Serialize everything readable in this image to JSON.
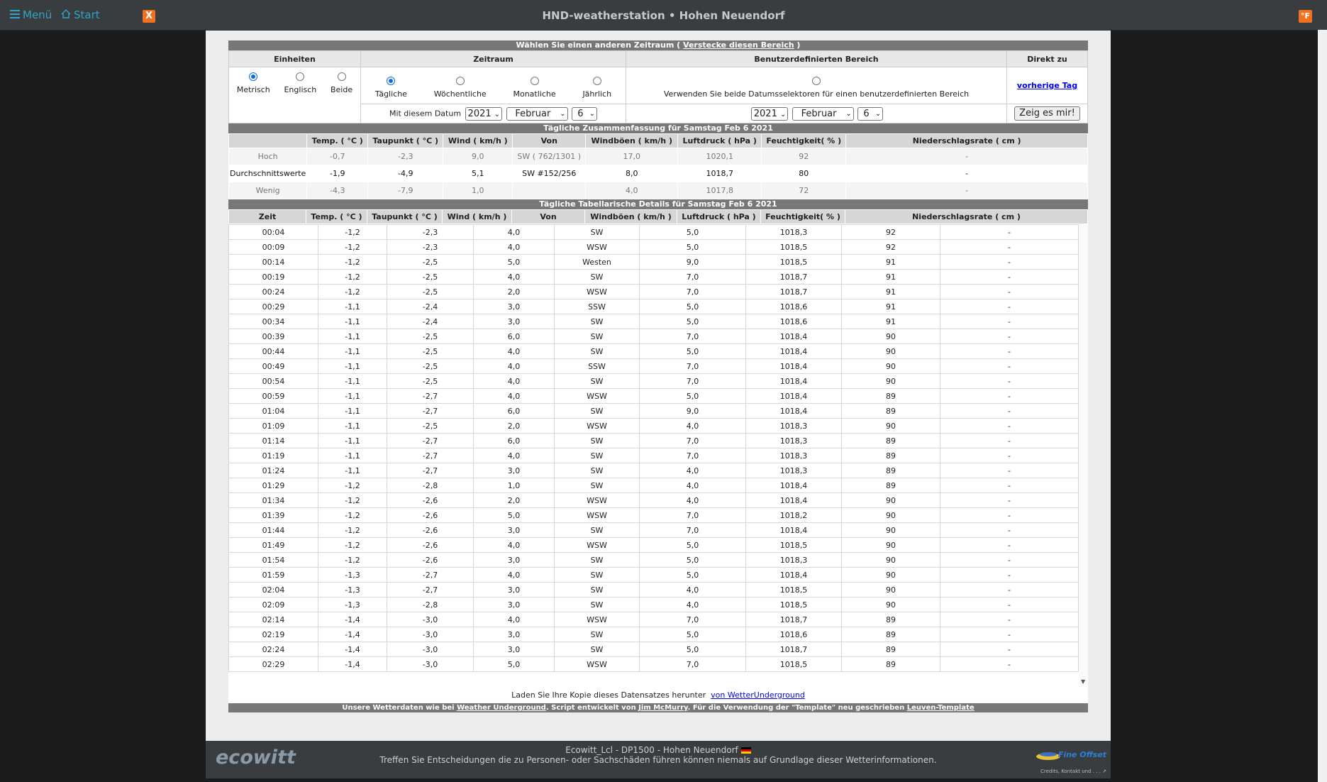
{
  "topbar": {
    "menu_label": "Menü",
    "start_label": "Start",
    "x_label": "X",
    "title": "HND-weatherstation  •  Hohen Neuendorf",
    "unit_label": "°F"
  },
  "selector": {
    "header_text": "Wählen Sie einen anderen Zeitraum (",
    "hide_link": "Verstecke diesen Bereich",
    "header_close": ")",
    "col_units": "Einheiten",
    "col_period": "Zeitraum",
    "col_custom": "Benutzerdefinierten Bereich",
    "col_direct": "Direkt zu",
    "units": [
      {
        "label": "Metrisch",
        "checked": true
      },
      {
        "label": "Englisch",
        "checked": false
      },
      {
        "label": "Beide",
        "checked": false
      }
    ],
    "periods": [
      {
        "label": "Tägliche",
        "checked": true
      },
      {
        "label": "Wöchentliche",
        "checked": false
      },
      {
        "label": "Monatliche",
        "checked": false
      },
      {
        "label": "Jährlich",
        "checked": false
      }
    ],
    "custom_text": "Verwenden Sie beide Datumsselektoren für einen benutzerdefinierten Bereich",
    "prev_day_link": "vorherige Tag",
    "date_label": "Mit diesem Datum",
    "year": "2021",
    "month": "Februar",
    "day": "6",
    "show_button": "Zeig es mir!"
  },
  "summary": {
    "title": "Tägliche Zusammenfassung für Samstag Feb 6 2021",
    "columns": [
      "",
      "Temp. ( °C )",
      "Taupunkt ( °C )",
      "Wind ( km/h )",
      "Von",
      "Windböen ( km/h )",
      "Luftdruck ( hPa )",
      "Feuchtigkeit( % )",
      "Niederschlagsrate ( cm )"
    ],
    "rows": [
      {
        "cls": "hoch",
        "cells": [
          "Hoch",
          "-0,7",
          "-2,3",
          "9,0",
          "SW ( 762/1301 )",
          "17,0",
          "1020,1",
          "92",
          "-"
        ]
      },
      {
        "cls": "avg",
        "cells": [
          "Durchschnittswerte",
          "-1,9",
          "-4,9",
          "5,1",
          "SW #152/256",
          "8,0",
          "1018,7",
          "80",
          "-"
        ]
      },
      {
        "cls": "wenig",
        "cells": [
          "Wenig",
          "-4,3",
          "-7,9",
          "1,0",
          "",
          "4,0",
          "1017,8",
          "72",
          "-"
        ]
      }
    ]
  },
  "details": {
    "title": "Tägliche Tabellarische Details für Samstag Feb 6 2021",
    "columns": [
      "Zeit",
      "Temp. ( °C )",
      "Taupunkt ( °C )",
      "Wind ( km/h )",
      "Von",
      "Windböen ( km/h )",
      "Luftdruck ( hPa )",
      "Feuchtigkeit( % )",
      "Niederschlagsrate ( cm )"
    ],
    "rows": [
      [
        "00:04",
        "-1,2",
        "-2,3",
        "4,0",
        "SW",
        "5,0",
        "1018,3",
        "92",
        "-"
      ],
      [
        "00:09",
        "-1,2",
        "-2,3",
        "4,0",
        "WSW",
        "5,0",
        "1018,5",
        "92",
        "-"
      ],
      [
        "00:14",
        "-1,2",
        "-2,5",
        "5,0",
        "Westen",
        "9,0",
        "1018,5",
        "91",
        "-"
      ],
      [
        "00:19",
        "-1,2",
        "-2,5",
        "4,0",
        "SW",
        "7,0",
        "1018,7",
        "91",
        "-"
      ],
      [
        "00:24",
        "-1,2",
        "-2,5",
        "2,0",
        "WSW",
        "7,0",
        "1018,7",
        "91",
        "-"
      ],
      [
        "00:29",
        "-1,1",
        "-2,4",
        "3,0",
        "SSW",
        "5,0",
        "1018,6",
        "91",
        "-"
      ],
      [
        "00:34",
        "-1,1",
        "-2,4",
        "3,0",
        "SW",
        "5,0",
        "1018,6",
        "91",
        "-"
      ],
      [
        "00:39",
        "-1,1",
        "-2,5",
        "6,0",
        "SW",
        "7,0",
        "1018,4",
        "90",
        "-"
      ],
      [
        "00:44",
        "-1,1",
        "-2,5",
        "4,0",
        "SW",
        "5,0",
        "1018,4",
        "90",
        "-"
      ],
      [
        "00:49",
        "-1,1",
        "-2,5",
        "4,0",
        "SSW",
        "7,0",
        "1018,4",
        "90",
        "-"
      ],
      [
        "00:54",
        "-1,1",
        "-2,5",
        "4,0",
        "SW",
        "7,0",
        "1018,4",
        "90",
        "-"
      ],
      [
        "00:59",
        "-1,1",
        "-2,7",
        "4,0",
        "WSW",
        "5,0",
        "1018,4",
        "89",
        "-"
      ],
      [
        "01:04",
        "-1,1",
        "-2,7",
        "6,0",
        "SW",
        "9,0",
        "1018,4",
        "89",
        "-"
      ],
      [
        "01:09",
        "-1,1",
        "-2,5",
        "2,0",
        "WSW",
        "4,0",
        "1018,3",
        "90",
        "-"
      ],
      [
        "01:14",
        "-1,1",
        "-2,7",
        "6,0",
        "SW",
        "7,0",
        "1018,3",
        "89",
        "-"
      ],
      [
        "01:19",
        "-1,1",
        "-2,7",
        "4,0",
        "SW",
        "7,0",
        "1018,3",
        "89",
        "-"
      ],
      [
        "01:24",
        "-1,1",
        "-2,7",
        "3,0",
        "SW",
        "4,0",
        "1018,3",
        "89",
        "-"
      ],
      [
        "01:29",
        "-1,2",
        "-2,8",
        "1,0",
        "SW",
        "4,0",
        "1018,4",
        "89",
        "-"
      ],
      [
        "01:34",
        "-1,2",
        "-2,6",
        "2,0",
        "WSW",
        "4,0",
        "1018,4",
        "90",
        "-"
      ],
      [
        "01:39",
        "-1,2",
        "-2,6",
        "5,0",
        "WSW",
        "7,0",
        "1018,2",
        "90",
        "-"
      ],
      [
        "01:44",
        "-1,2",
        "-2,6",
        "3,0",
        "SW",
        "7,0",
        "1018,4",
        "90",
        "-"
      ],
      [
        "01:49",
        "-1,2",
        "-2,6",
        "4,0",
        "WSW",
        "5,0",
        "1018,5",
        "90",
        "-"
      ],
      [
        "01:54",
        "-1,2",
        "-2,6",
        "3,0",
        "SW",
        "5,0",
        "1018,3",
        "90",
        "-"
      ],
      [
        "01:59",
        "-1,3",
        "-2,7",
        "4,0",
        "SW",
        "5,0",
        "1018,4",
        "90",
        "-"
      ],
      [
        "02:04",
        "-1,3",
        "-2,7",
        "3,0",
        "SW",
        "4,0",
        "1018,5",
        "90",
        "-"
      ],
      [
        "02:09",
        "-1,3",
        "-2,8",
        "3,0",
        "SW",
        "4,0",
        "1018,5",
        "90",
        "-"
      ],
      [
        "02:14",
        "-1,4",
        "-3,0",
        "4,0",
        "WSW",
        "7,0",
        "1018,7",
        "89",
        "-"
      ],
      [
        "02:19",
        "-1,4",
        "-3,0",
        "3,0",
        "SW",
        "5,0",
        "1018,6",
        "89",
        "-"
      ],
      [
        "02:24",
        "-1,4",
        "-3,0",
        "3,0",
        "SW",
        "5,0",
        "1018,7",
        "89",
        "-"
      ],
      [
        "02:29",
        "-1,4",
        "-3,0",
        "5,0",
        "WSW",
        "7,0",
        "1018,5",
        "89",
        "-"
      ]
    ]
  },
  "download": {
    "text": "Laden Sie Ihre Kopie dieses Datensatzes herunter",
    "link": "von WetterUnderground"
  },
  "credits": {
    "t1": "Unsere Wetterdaten wie bei ",
    "l1": "Weather Underground",
    "t2": ". Script entwickelt von ",
    "l2": "Jim McMurry",
    "t3": ". Für die Verwendung der \"Template\" neu geschrieben ",
    "l3": "Leuven-Template"
  },
  "footer": {
    "logo": "ecowitt",
    "line1": "Ecowitt_Lcl  -  DP1500  -  Hohen Neuendorf",
    "line2": "Treffen Sie Entscheidungen die zu Personen- oder Sachschäden führen können niemals auf Grundlage dieser Wetterinformationen.",
    "brand": "Fine Offset",
    "credits_link": "Credits, Kontakt und . . ."
  }
}
